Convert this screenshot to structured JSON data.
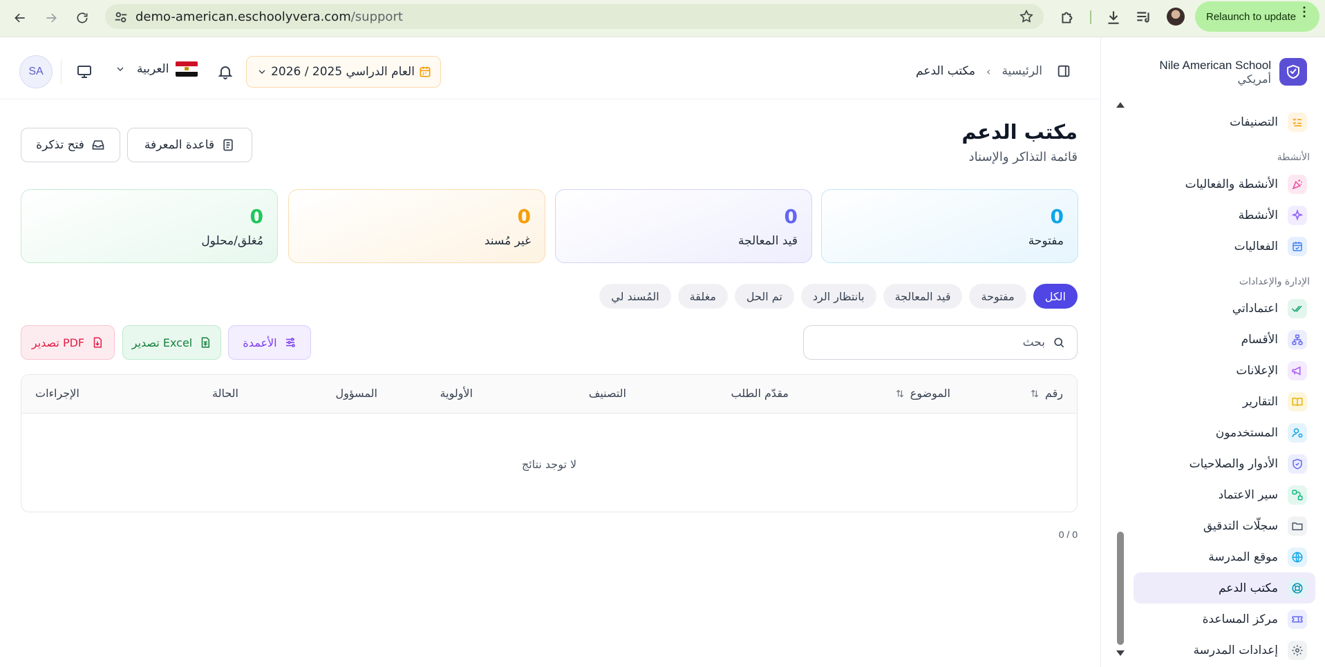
{
  "browser": {
    "url_host": "demo-american.eschoolyvera.com",
    "url_path": "/support",
    "relaunch_label": "Relaunch to update"
  },
  "brand": {
    "name": "Nile American School",
    "subtitle": "أمريكي"
  },
  "sidebar": {
    "items_top": [
      {
        "label": "التصنيفات",
        "icon": "checklist-icon",
        "color": "#f59e0b",
        "bg": "#fff4e0"
      }
    ],
    "section_activities": "الأنشطة",
    "items_activities": [
      {
        "label": "الأنشطة والفعاليات",
        "icon": "party-icon",
        "color": "#ec4899",
        "bg": "#fde8f2"
      },
      {
        "label": "الأنشطة",
        "icon": "sparkles-icon",
        "color": "#8b5cf6",
        "bg": "#f1ecfe"
      },
      {
        "label": "الفعاليات",
        "icon": "calendar-icon",
        "color": "#3b82f6",
        "bg": "#e6effd"
      }
    ],
    "section_admin": "الإدارة والإعدادات",
    "items_admin": [
      {
        "label": "اعتماداتي",
        "icon": "double-check-icon",
        "color": "#0f9f6e",
        "bg": "#e3f6ee"
      },
      {
        "label": "الأقسام",
        "icon": "sitemap-icon",
        "color": "#6366f1",
        "bg": "#ecedfd"
      },
      {
        "label": "الإعلانات",
        "icon": "megaphone-icon",
        "color": "#a855f7",
        "bg": "#f4ebfe"
      },
      {
        "label": "التقارير",
        "icon": "book-icon",
        "color": "#eab308",
        "bg": "#fdf6dc"
      },
      {
        "label": "المستخدمون",
        "icon": "user-cog-icon",
        "color": "#0ea5e9",
        "bg": "#e4f4fc"
      },
      {
        "label": "الأدوار والصلاحيات",
        "icon": "shield-icon",
        "color": "#6366f1",
        "bg": "#ecedfd"
      },
      {
        "label": "سير الاعتماد",
        "icon": "workflow-icon",
        "color": "#10b981",
        "bg": "#e3f7ef"
      },
      {
        "label": "سجلّات التدقيق",
        "icon": "folder-icon",
        "color": "#4b5563",
        "bg": "#f1f2f4"
      },
      {
        "label": "موقع المدرسة",
        "icon": "globe-icon",
        "color": "#0ea5e9",
        "bg": "#e4f4fc"
      },
      {
        "label": "مكتب الدعم",
        "icon": "lifebuoy-icon",
        "color": "#0891b2",
        "bg": "#e0f3f7",
        "active": true
      },
      {
        "label": "مركز المساعدة",
        "icon": "ticket-icon",
        "color": "#6366f1",
        "bg": "#ecedfd"
      },
      {
        "label": "إعدادات المدرسة",
        "icon": "gear-icon",
        "color": "#4b5563",
        "bg": "#f1f2f4"
      }
    ]
  },
  "topbar": {
    "avatar_initials": "SA",
    "language": "العربية",
    "academic_year": "العام الدراسي 2025 / 2026",
    "breadcrumb_home": "الرئيسية",
    "breadcrumb_current": "مكتب الدعم"
  },
  "page": {
    "title": "مكتب الدعم",
    "subtitle": "قائمة التذاكر والإسناد",
    "knowledge_base_label": "قاعدة المعرفة",
    "open_ticket_label": "فتح تذكرة"
  },
  "stats": [
    {
      "value": "0",
      "label": "مفتوحة",
      "color": "#0ea5e9"
    },
    {
      "value": "0",
      "label": "قيد المعالجة",
      "color": "#6366f1"
    },
    {
      "value": "0",
      "label": "غير مُسند",
      "color": "#f59e0b"
    },
    {
      "value": "0",
      "label": "مُغلق/محلول",
      "color": "#22c55e"
    }
  ],
  "filters": [
    "الكل",
    "مفتوحة",
    "قيد المعالجة",
    "بانتظار الرد",
    "تم الحل",
    "مغلقة",
    "المُسند لي"
  ],
  "search": {
    "placeholder": "بحث"
  },
  "toolbar": {
    "columns_label": "الأعمدة",
    "excel_label": "تصدير Excel",
    "pdf_label": "تصدير PDF"
  },
  "table": {
    "headers": [
      "رقم",
      "الموضوع",
      "مقدّم الطلب",
      "التصنيف",
      "الأولوية",
      "المسؤول",
      "الحالة",
      "الإجراءات"
    ],
    "empty_text": "لا توجد نتائج",
    "count_text": "0 / 0"
  }
}
